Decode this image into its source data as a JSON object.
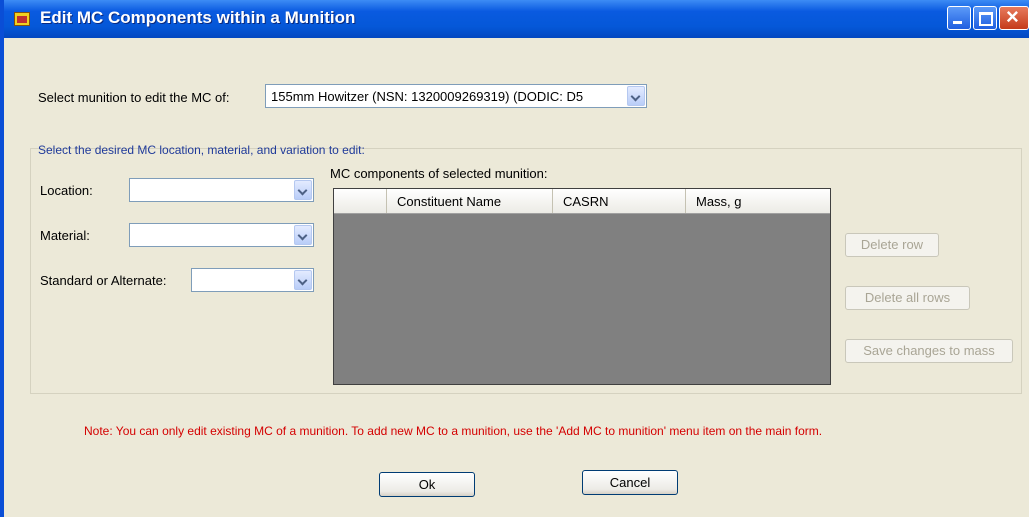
{
  "window": {
    "title": "Edit MC Components within a Munition"
  },
  "munition": {
    "label": "Select munition to edit the MC of:",
    "selected": "155mm Howitzer (NSN: 1320009269319) (DODIC: D5"
  },
  "selection_group": {
    "caption": "Select the desired MC location, material, and variation to edit:",
    "location_label": "Location:",
    "location_value": "",
    "material_label": "Material:",
    "material_value": "",
    "standard_label": "Standard or Alternate:",
    "standard_value": ""
  },
  "grid": {
    "caption": "MC components of selected munition:",
    "columns": [
      "Constituent Name",
      "CASRN",
      "Mass, g"
    ],
    "rows": []
  },
  "side_buttons": {
    "delete_row": "Delete row",
    "delete_all_rows": "Delete all rows",
    "save_changes": "Save changes to mass"
  },
  "note": "Note: You can only edit existing MC of a munition.  To add new MC to a munition, use the 'Add MC to munition' menu item on the main form.",
  "dialog_buttons": {
    "ok": "Ok",
    "cancel": "Cancel"
  }
}
